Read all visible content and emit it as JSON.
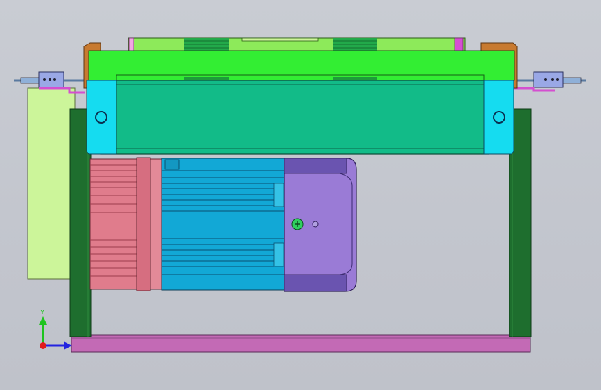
{
  "window": {
    "type": "cad-viewport",
    "view": "front"
  },
  "axis_triad": {
    "y_label": "Y",
    "x_label": "",
    "colors": {
      "y": "#1ec41e",
      "x": "#2323e0",
      "origin": "#e01c1c"
    }
  },
  "colors": {
    "background": "#c6c9d0",
    "frame_green": "#1e6e2e",
    "base_plate": "#c36ab5",
    "top_plate": "#33ee33",
    "conveyor_body": "#12bb88",
    "bracket_cyan": "#15dcf0",
    "bracket_orange": "#c87a30",
    "motor_pink": "#e07c8c",
    "motor_blue": "#12a8d6",
    "gearbox_purple": "#9a7bd6",
    "side_panel": "#ccf59a"
  },
  "icons": [
    "view-triad-icon",
    "screw-icon",
    "mount-hole-icon"
  ]
}
